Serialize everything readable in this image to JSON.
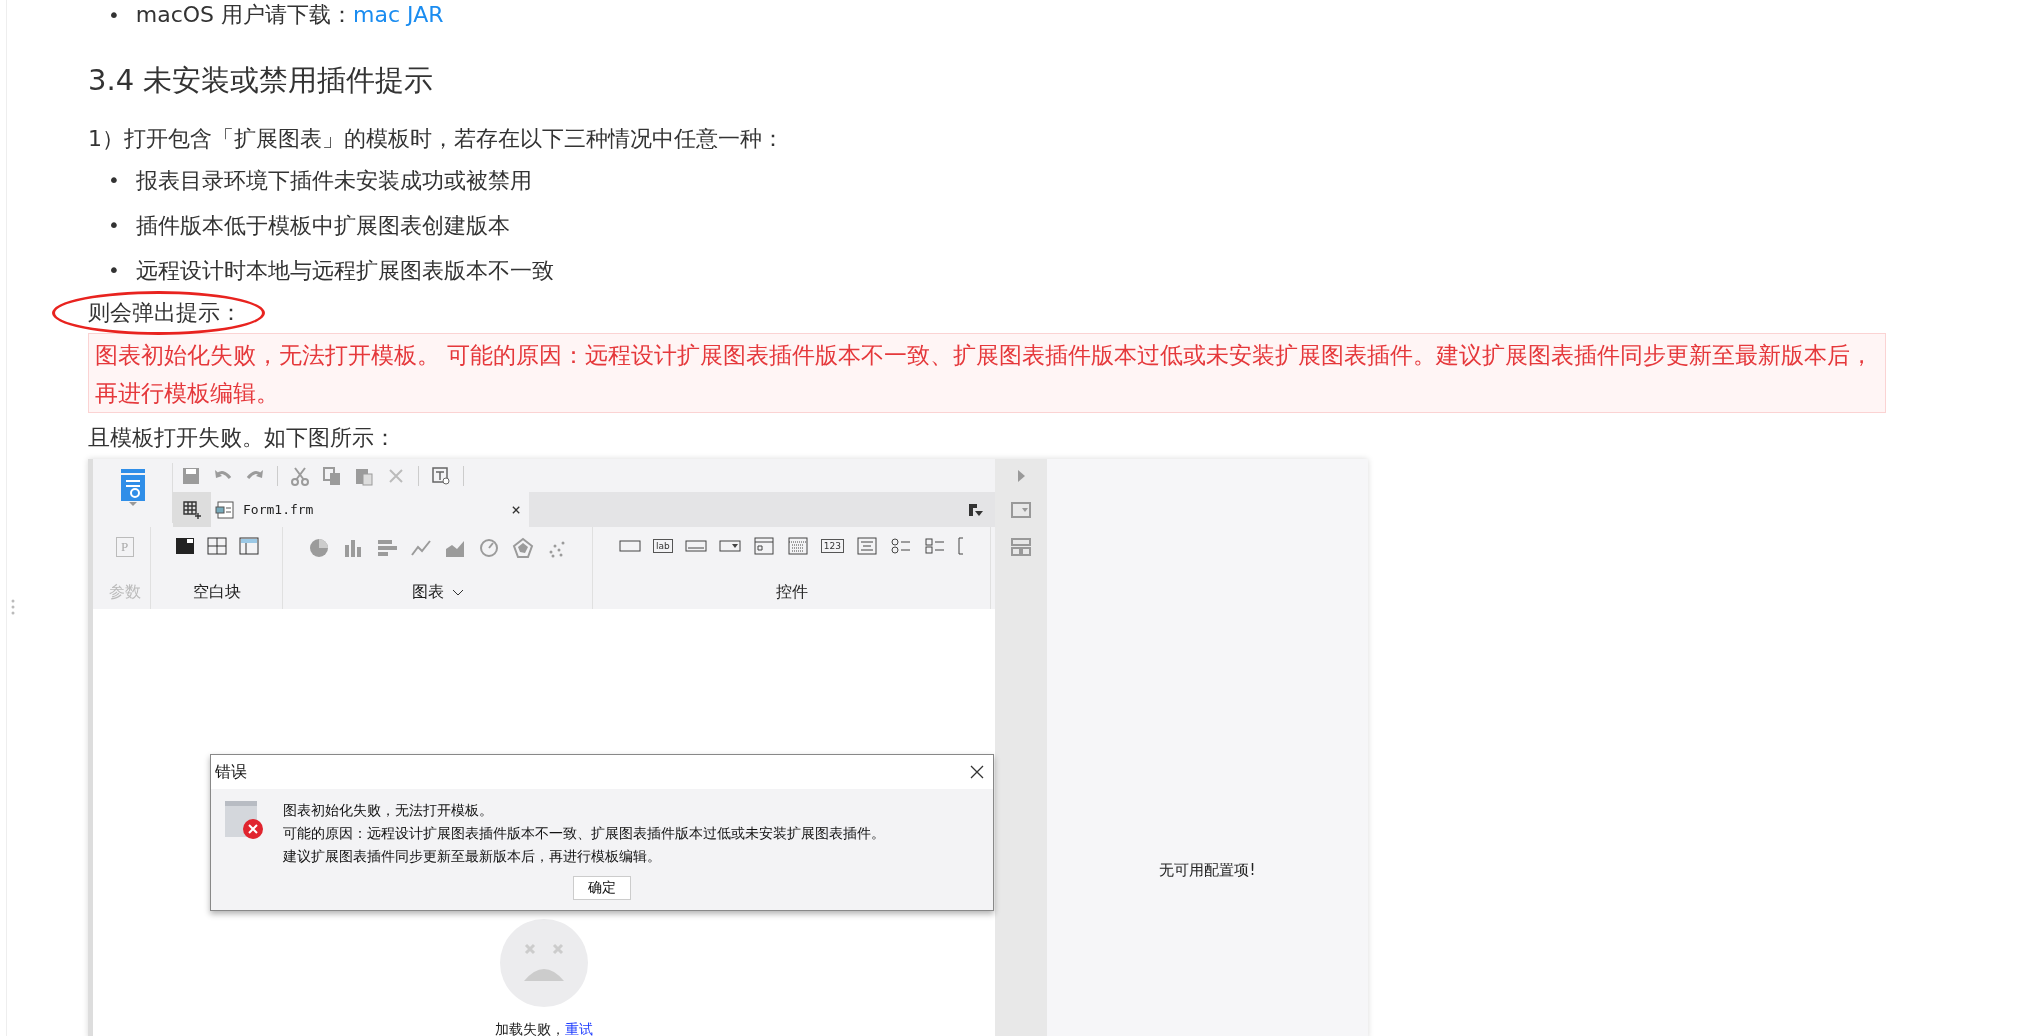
{
  "download_item": {
    "bullet": "•",
    "label": "macOS 用户请下载：",
    "link": "mac JAR"
  },
  "section_heading": "3.4 未安装或禁用插件提示",
  "intro": "1）打开包含「扩展图表」的模板时，若存在以下三种情况中任意一种：",
  "conditions": [
    {
      "bullet": "•",
      "text": "报表目录环境下插件未安装成功或被禁用"
    },
    {
      "bullet": "•",
      "text": "插件版本低于模板中扩展图表创建版本"
    },
    {
      "bullet": "•",
      "text": "远程设计时本地与远程扩展图表版本不一致"
    }
  ],
  "popup_note": {
    "text": "则会弹出提示：",
    "circled": true
  },
  "alert_message": "图表初始化失败，无法打开模板。 可能的原因：远程设计扩展图表插件版本不一致、扩展图表插件版本过低或未安装扩展图表插件。建议扩展图表插件同步更新至最新版本后，再进行模板编辑。",
  "figure_caption": "且模板打开失败。如下图所示：",
  "designer": {
    "tab": {
      "label": "Form1.frm",
      "close": "×"
    },
    "ribbon_groups": [
      {
        "kind": "param",
        "label": "参数",
        "disabled": true,
        "glyph": "P"
      },
      {
        "kind": "blank",
        "label": "空白块",
        "disabled": false
      },
      {
        "kind": "chart",
        "label": "图表",
        "disabled": false
      },
      {
        "kind": "widget",
        "label": "控件",
        "disabled": false,
        "glyphs": [
          "lab",
          "123"
        ]
      }
    ],
    "error_dialog": {
      "title": "错误",
      "lines": [
        "图表初始化失败，无法打开模板。",
        "可能的原因：远程设计扩展图表插件版本不一致、扩展图表插件版本过低或未安装扩展图表插件。",
        "建议扩展图表插件同步更新至最新版本后，再进行模板编辑。"
      ],
      "ok_button": "确定"
    },
    "load_failed": {
      "text": "加载失败，",
      "retry_link": "重试"
    },
    "config_panel": {
      "empty_text": "无可用配置项!"
    }
  }
}
